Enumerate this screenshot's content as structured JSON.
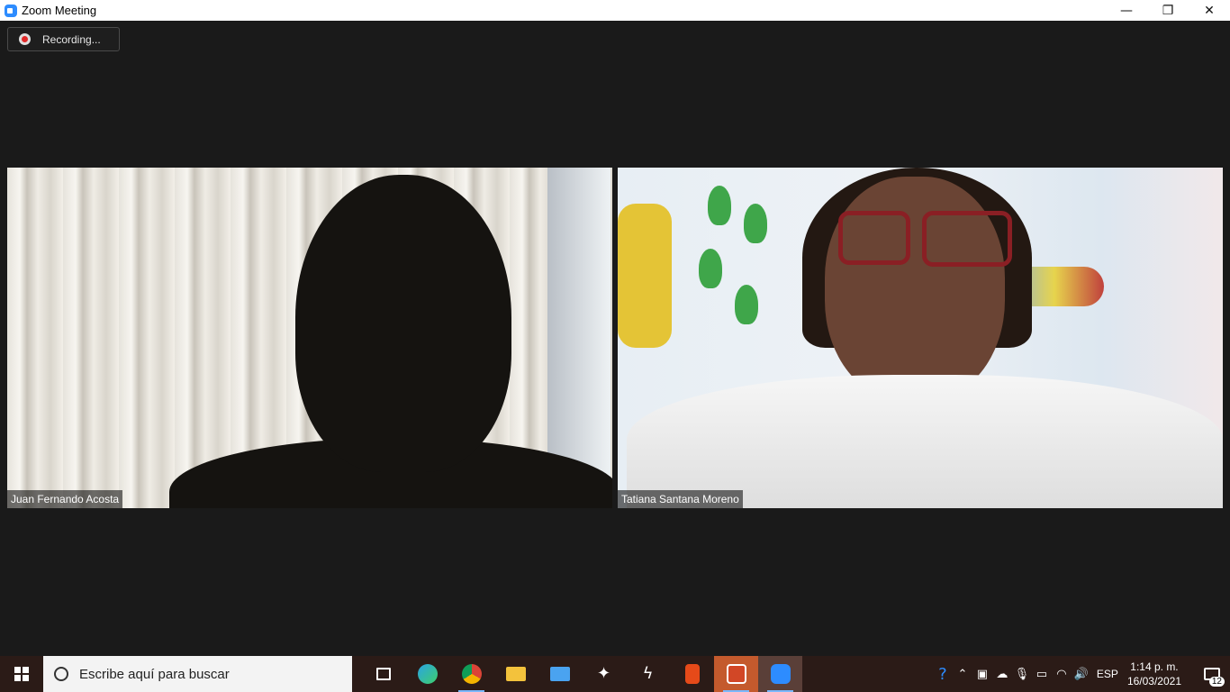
{
  "window": {
    "title": "Zoom Meeting",
    "controls": {
      "minimize": "—",
      "restore": "❐",
      "close": "✕"
    }
  },
  "recording": {
    "label": "Recording..."
  },
  "participants": [
    {
      "name": "Juan Fernando Acosta"
    },
    {
      "name": "Tatiana Santana Moreno"
    }
  ],
  "taskbar": {
    "search_placeholder": "Escribe aquí para buscar",
    "apps": [
      {
        "name": "task-view",
        "color": "#ffffff"
      },
      {
        "name": "edge",
        "color": "#2aa3e4"
      },
      {
        "name": "chrome",
        "color": "#f4b400"
      },
      {
        "name": "file-explorer",
        "color": "#f3c23c"
      },
      {
        "name": "mail",
        "color": "#4aa3f0"
      },
      {
        "name": "dropbox",
        "color": "#ffffff"
      },
      {
        "name": "app-bolt",
        "color": "#ffffff"
      },
      {
        "name": "office",
        "color": "#e64a19"
      },
      {
        "name": "powerpoint",
        "color": "#d24726"
      },
      {
        "name": "zoom",
        "color": "#2d8cff"
      }
    ],
    "tray": {
      "language": "ESP",
      "time": "1:14 p. m.",
      "date": "16/03/2021",
      "notification_count": "12"
    }
  }
}
